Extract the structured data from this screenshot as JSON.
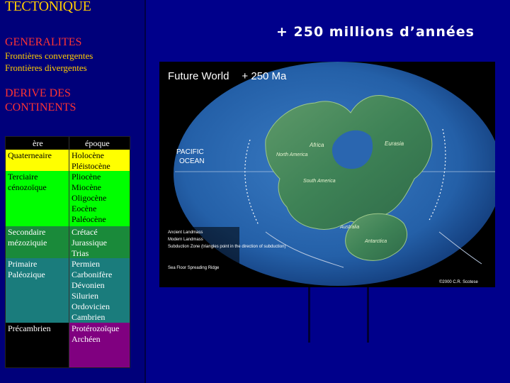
{
  "sidebar": {
    "title": "TECTONIQUE",
    "section1": {
      "title": "GENERALITES",
      "items": [
        "Frontières convergentes",
        "Frontières divergentes"
      ]
    },
    "section2": {
      "title_line1": "DERIVE DES",
      "title_line2": "CONTINENTS"
    },
    "table": {
      "headers": [
        "ère",
        "époque"
      ],
      "rows": [
        {
          "era": [
            "Quaterneaire"
          ],
          "epochs": [
            "Holocène",
            "Pléistocène"
          ],
          "color": "#ffff00"
        },
        {
          "era": [
            "Terciaire",
            "cénozoïque"
          ],
          "epochs": [
            "Pliocène",
            "Miocène",
            "Oligocène",
            "Eocène",
            "Paléocène"
          ],
          "color": "#00ff00"
        },
        {
          "era": [
            "Secondaire",
            "mézoziquie"
          ],
          "epochs": [
            "Crétacé",
            "Jurassique",
            "Trias"
          ],
          "color": "#1a8a3a"
        },
        {
          "era": [
            "Primaire",
            "Paléozique"
          ],
          "epochs": [
            "Permien",
            "Carbonifère",
            "Dévonien",
            "Silurien",
            "Ordovicien",
            "Cambrien"
          ],
          "color": "#1a7c7c"
        },
        {
          "era": [
            "Précambrien"
          ],
          "epochs": [
            "Protérozoïque",
            "Archéen"
          ],
          "color": "#800080"
        }
      ]
    }
  },
  "main": {
    "heading": "+ 250 millions d’années",
    "map": {
      "title": "Future World",
      "age": "+ 250 Ma",
      "ocean_label": [
        "PACIFIC",
        "OCEAN"
      ],
      "continent_labels": [
        "Africa",
        "Eurasia",
        "North America",
        "South America",
        "Australia",
        "Antarctica"
      ],
      "legend": [
        "Ancient Landmass",
        "Modern Landmass",
        "Subduction Zone (triangles point in the direction of subduction)",
        "Sea Floor Spreading Ridge"
      ],
      "copyright": "©2000 C.R. Scotese"
    }
  }
}
